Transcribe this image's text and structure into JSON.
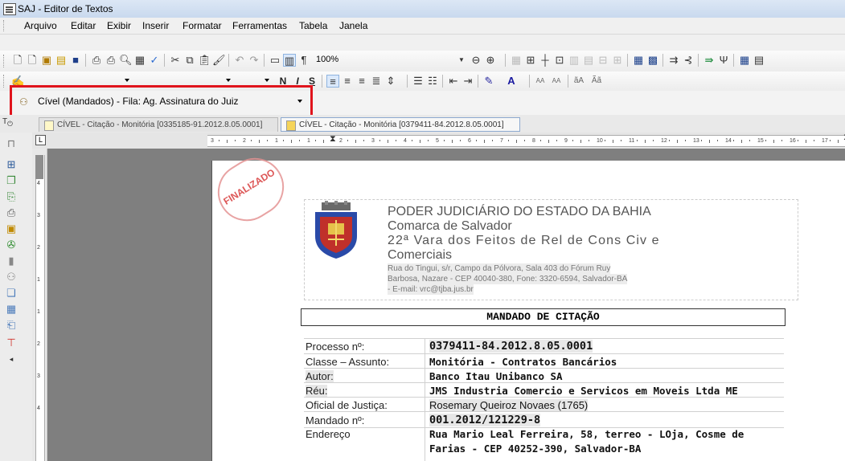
{
  "window": {
    "title": "SAJ - Editor de Textos"
  },
  "menu": [
    {
      "label": "Arquivo"
    },
    {
      "label": "Editar"
    },
    {
      "label": "Exibir"
    },
    {
      "label": "Inserir"
    },
    {
      "label": "Formatar"
    },
    {
      "label": "Ferramentas"
    },
    {
      "label": "Tabela"
    },
    {
      "label": "Janela"
    }
  ],
  "toolbar": {
    "zoom": "100%",
    "font_name": "",
    "font_size": "",
    "style": ""
  },
  "queue": {
    "selected": "Cível (Mandados) - Fila: Ag. Assinatura do Juiz"
  },
  "tabs": [
    {
      "label": "CÍVEL - Citação - Monitória [0335185-91.2012.8.05.0001]",
      "active": false
    },
    {
      "label": "CÍVEL - Citação - Monitória [0379411-84.2012.8.05.0001]",
      "active": true
    }
  ],
  "ruler": {
    "numbers": [
      "3",
      "2",
      "1",
      "1",
      "2",
      "3",
      "4",
      "5",
      "6",
      "7",
      "8",
      "9",
      "10",
      "11",
      "12",
      "13",
      "14",
      "15",
      "16",
      "17"
    ]
  },
  "vruler": {
    "numbers": [
      "4",
      "3",
      "2",
      "1",
      "1",
      "2",
      "3",
      "4"
    ]
  },
  "document": {
    "stamp": "FINALIZADO",
    "header": {
      "line1": "PODER JUDICIÁRIO DO ESTADO DA BAHIA",
      "line2": "Comarca de Salvador",
      "line3": "22ª Vara dos Feitos de Rel de Cons Civ e",
      "line4": "Comerciais",
      "address1": "Rua do Tingui, s/r, Campo da Pólvora, Sala 403 do Fórum Ruy",
      "address2": "Barbosa, Nazare - CEP 40040-380, Fone: 3320-6594, Salvador-BA",
      "address3": "- E-mail: vrc@tjba.jus.br"
    },
    "title": "MANDADO DE CITAÇÃO",
    "fields": [
      {
        "label": "Processo nº:",
        "value": "0379411-84.2012.8.05.0001"
      },
      {
        "label": "Classe – Assunto:",
        "value": "Monitória - Contratos Bancários"
      },
      {
        "label": "Autor:",
        "value": "Banco Itau Unibanco SA"
      },
      {
        "label": "Réu:",
        "value": "JMS Industria Comercio e Servicos em Moveis Ltda ME"
      },
      {
        "label": "Oficial de Justiça:",
        "value": "Rosemary Queiroz Novaes (1765)"
      },
      {
        "label": "Mandado nº:",
        "value": "001.2012/121229-8"
      },
      {
        "label": "Endereço",
        "value": "Rua Mario Leal Ferreira, 58, terreo - LOja, Cosme de"
      },
      {
        "label": "",
        "value": "Farias - CEP 40252-390, Salvador-BA"
      }
    ]
  },
  "colors": {
    "highlight": "#e0141c",
    "page_bg": "#ffffff",
    "workspace": "#7f7f7f"
  }
}
